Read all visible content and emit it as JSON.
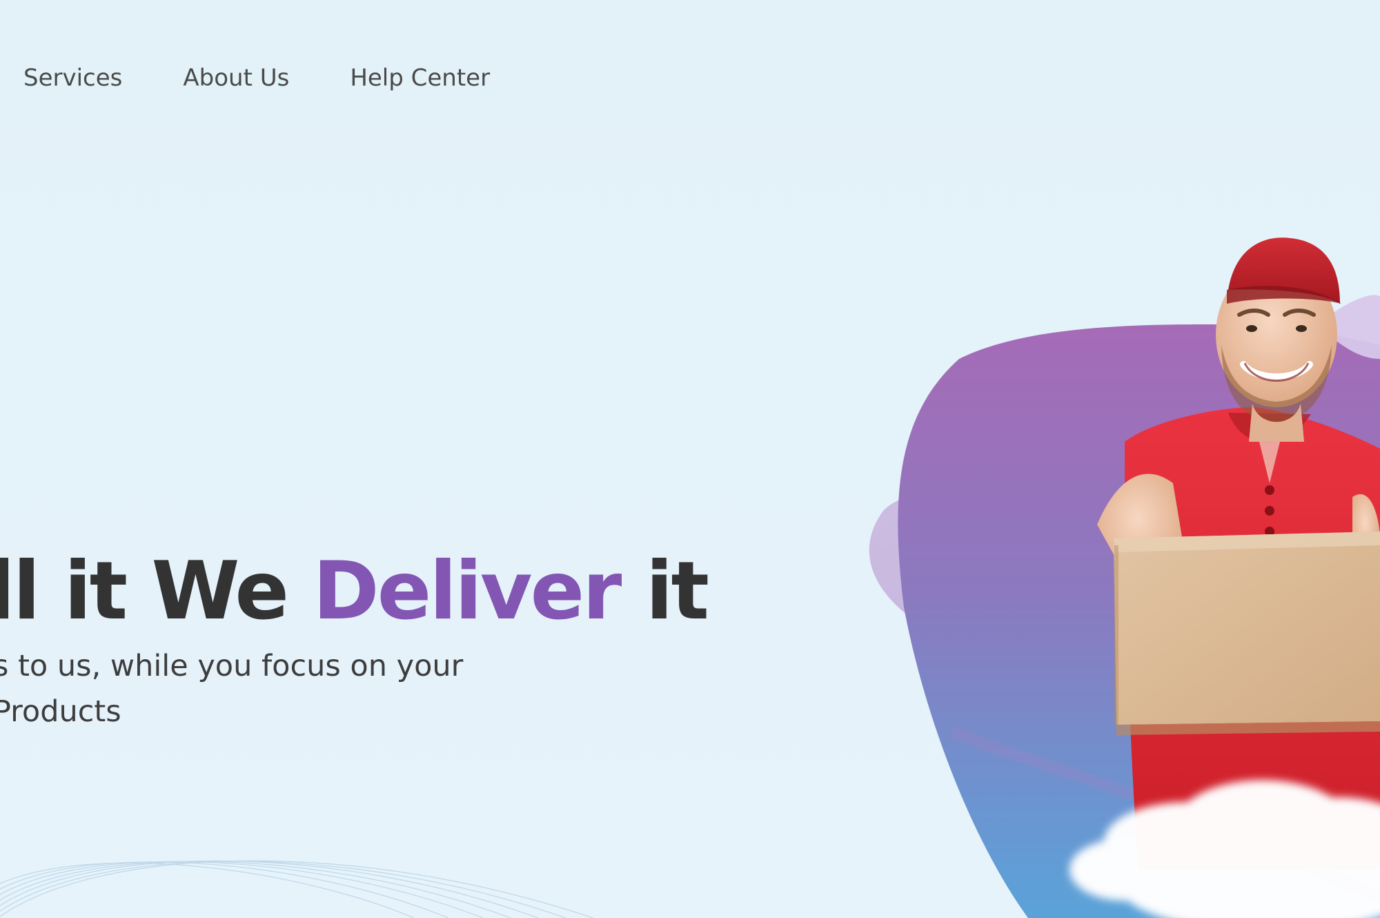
{
  "nav": {
    "items": [
      {
        "label": "Services"
      },
      {
        "label": "About Us"
      },
      {
        "label": "Help Center"
      }
    ]
  },
  "hero": {
    "headline_part1": "ll it We ",
    "headline_accent": "Deliver",
    "headline_part3": " it",
    "subtext_line1": "s to us, while you focus on your",
    "subtext_line2": "Products"
  },
  "colors": {
    "background": "#e4f2fa",
    "accent": "#8356b3",
    "text": "#333333",
    "shirt": "#e02b35"
  },
  "icons": {
    "decoration": "wave-lines"
  }
}
